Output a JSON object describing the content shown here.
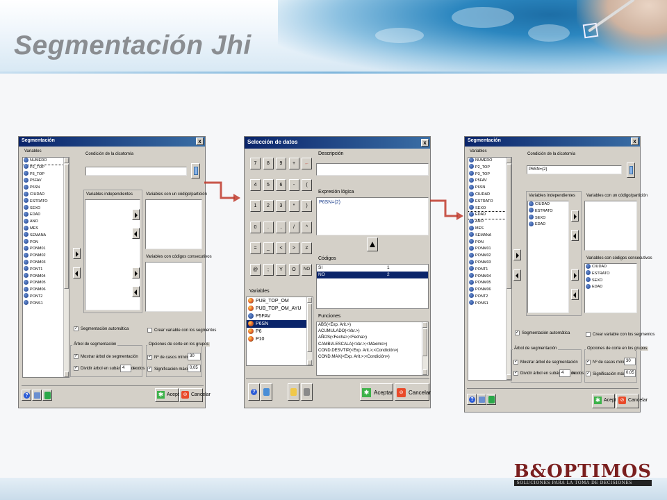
{
  "slide": {
    "title": "Segmentación Jhi",
    "logo": {
      "main": "B&OPTIMOS",
      "sub": "SOLUCIONES PARA LA TOMA DE DECISIONES"
    }
  },
  "left_dialog": {
    "title": "Segmentación",
    "variables_label": "Variables",
    "variables": [
      "NUMERO",
      "P2_TOP",
      "P3_TOP",
      "P5FAV",
      "P6SN",
      "CIUDAD",
      "ESTRATO",
      "SEXO",
      "EDAD",
      "ANO",
      "MES",
      "SEMANA",
      "PON",
      "PONM01",
      "PONM02",
      "PONM03",
      "PONT1",
      "PONM04",
      "PONM05",
      "PONM06",
      "PONT2",
      "PONS1"
    ],
    "condicion_label": "Condición de la dicotomía",
    "condicion_value": "",
    "indep_label": "Variables independientes",
    "codigo_label": "Variables con un código/partición",
    "consec_label": "Variables con códigos consecutivos",
    "seg_auto": "Segmentación automática",
    "crear_var": "Crear variable con los segmentos",
    "arbol_label": "Árbol de segmentación",
    "mostrar_arbol": "Mostrar árbol de segmentación",
    "dividir_arbol": "Dividir árbol en subárboles de",
    "nodos_value": "4",
    "nodos_label": "nodos",
    "opciones_label": "Opciones de corte en los grupos",
    "casos_label": "Nº de casos mínimo",
    "casos_value": "30",
    "signif_label": "Significación máxima",
    "signif_value": "0,05",
    "aceptar": "Aceptar",
    "cancelar": "Cancelar"
  },
  "mid_dialog": {
    "title": "Selección de datos",
    "keys": [
      "7",
      "8",
      "9",
      "+",
      "←",
      "4",
      "5",
      "6",
      "-",
      "(",
      "1",
      "2",
      "3",
      "*",
      ")",
      "0",
      ".",
      ",",
      "/",
      "^",
      "=",
      "_",
      "<",
      ">",
      "≠",
      "@",
      ";",
      "Y",
      "O",
      "NO"
    ],
    "descripcion_label": "Descripción",
    "descripcion_value": "",
    "expresion_label": "Expresión lógica",
    "expresion_value": "P6SN=(2)",
    "codigos_label": "Códigos",
    "codigos": [
      {
        "name": "SI",
        "value": "1"
      },
      {
        "name": "NO",
        "value": "2"
      }
    ],
    "variables_label": "Variables",
    "variables": [
      "PUB_TOP_OM",
      "PUB_TOP_OM_AYU",
      "P5FAV",
      "P6SN",
      "P6",
      "P10"
    ],
    "funciones_label": "Funciones",
    "funciones": [
      "ABS(<Exp. Arit.>)",
      "ACUMULADO(<Var.>)",
      "AÑOS(<Fecha>;<Fecha>)",
      "CAMBIA.ESCALA(<Var.>;<Máximo>)",
      "COND.DESVTIP(<Exp. Arit.>;<Condición>)",
      "COND.MAX(<Exp. Arit.>;<Condición>)"
    ],
    "aceptar": "Aceptar",
    "cancelar": "Cancelar"
  },
  "right_dialog": {
    "title": "Segmentación",
    "variables_label": "Variables",
    "variables": [
      "NUMERO",
      "P2_TOP",
      "P3_TOP",
      "P5FAV",
      "P6SN",
      "CIUDAD",
      "ESTRATO",
      "SEXO",
      "EDAD",
      "ANO",
      "MES",
      "SEMANA",
      "PON",
      "PONM01",
      "PONM02",
      "PONM03",
      "PONT1",
      "PONM04",
      "PONM05",
      "PONM06",
      "PONT2",
      "PONS1"
    ],
    "condicion_label": "Condición de la dicotomía",
    "condicion_value": "P6SN=(2)",
    "indep_label": "Variables independientes",
    "indep_items": [
      "CIUDAD",
      "ESTRATO",
      "SEXO",
      "EDAD"
    ],
    "codigo_label": "Variables con un código/partición",
    "consec_label": "Variables con códigos consecutivos",
    "consec_items": [
      "CIUDAD",
      "ESTRATO",
      "SEXO",
      "EDAD"
    ],
    "seg_auto": "Segmentación automática",
    "crear_var": "Crear variable con los segmentos",
    "arbol_label": "Árbol de segmentación",
    "mostrar_arbol": "Mostrar árbol de segmentación",
    "dividir_arbol": "Dividir árbol en subárboles de",
    "nodos_value": "4",
    "nodos_label": "nodos",
    "opciones_label": "Opciones de corte en los grupos",
    "casos_label": "Nº de casos mínimo",
    "casos_value": "30",
    "signif_label": "Significación máxima",
    "signif_value": "0,05",
    "aceptar": "Aceptar",
    "cancelar": "Cancelar"
  },
  "colors": {
    "titlebar": "#0a246a",
    "flow_arrow": "#c0392b",
    "title_text": "#8a8d91"
  }
}
